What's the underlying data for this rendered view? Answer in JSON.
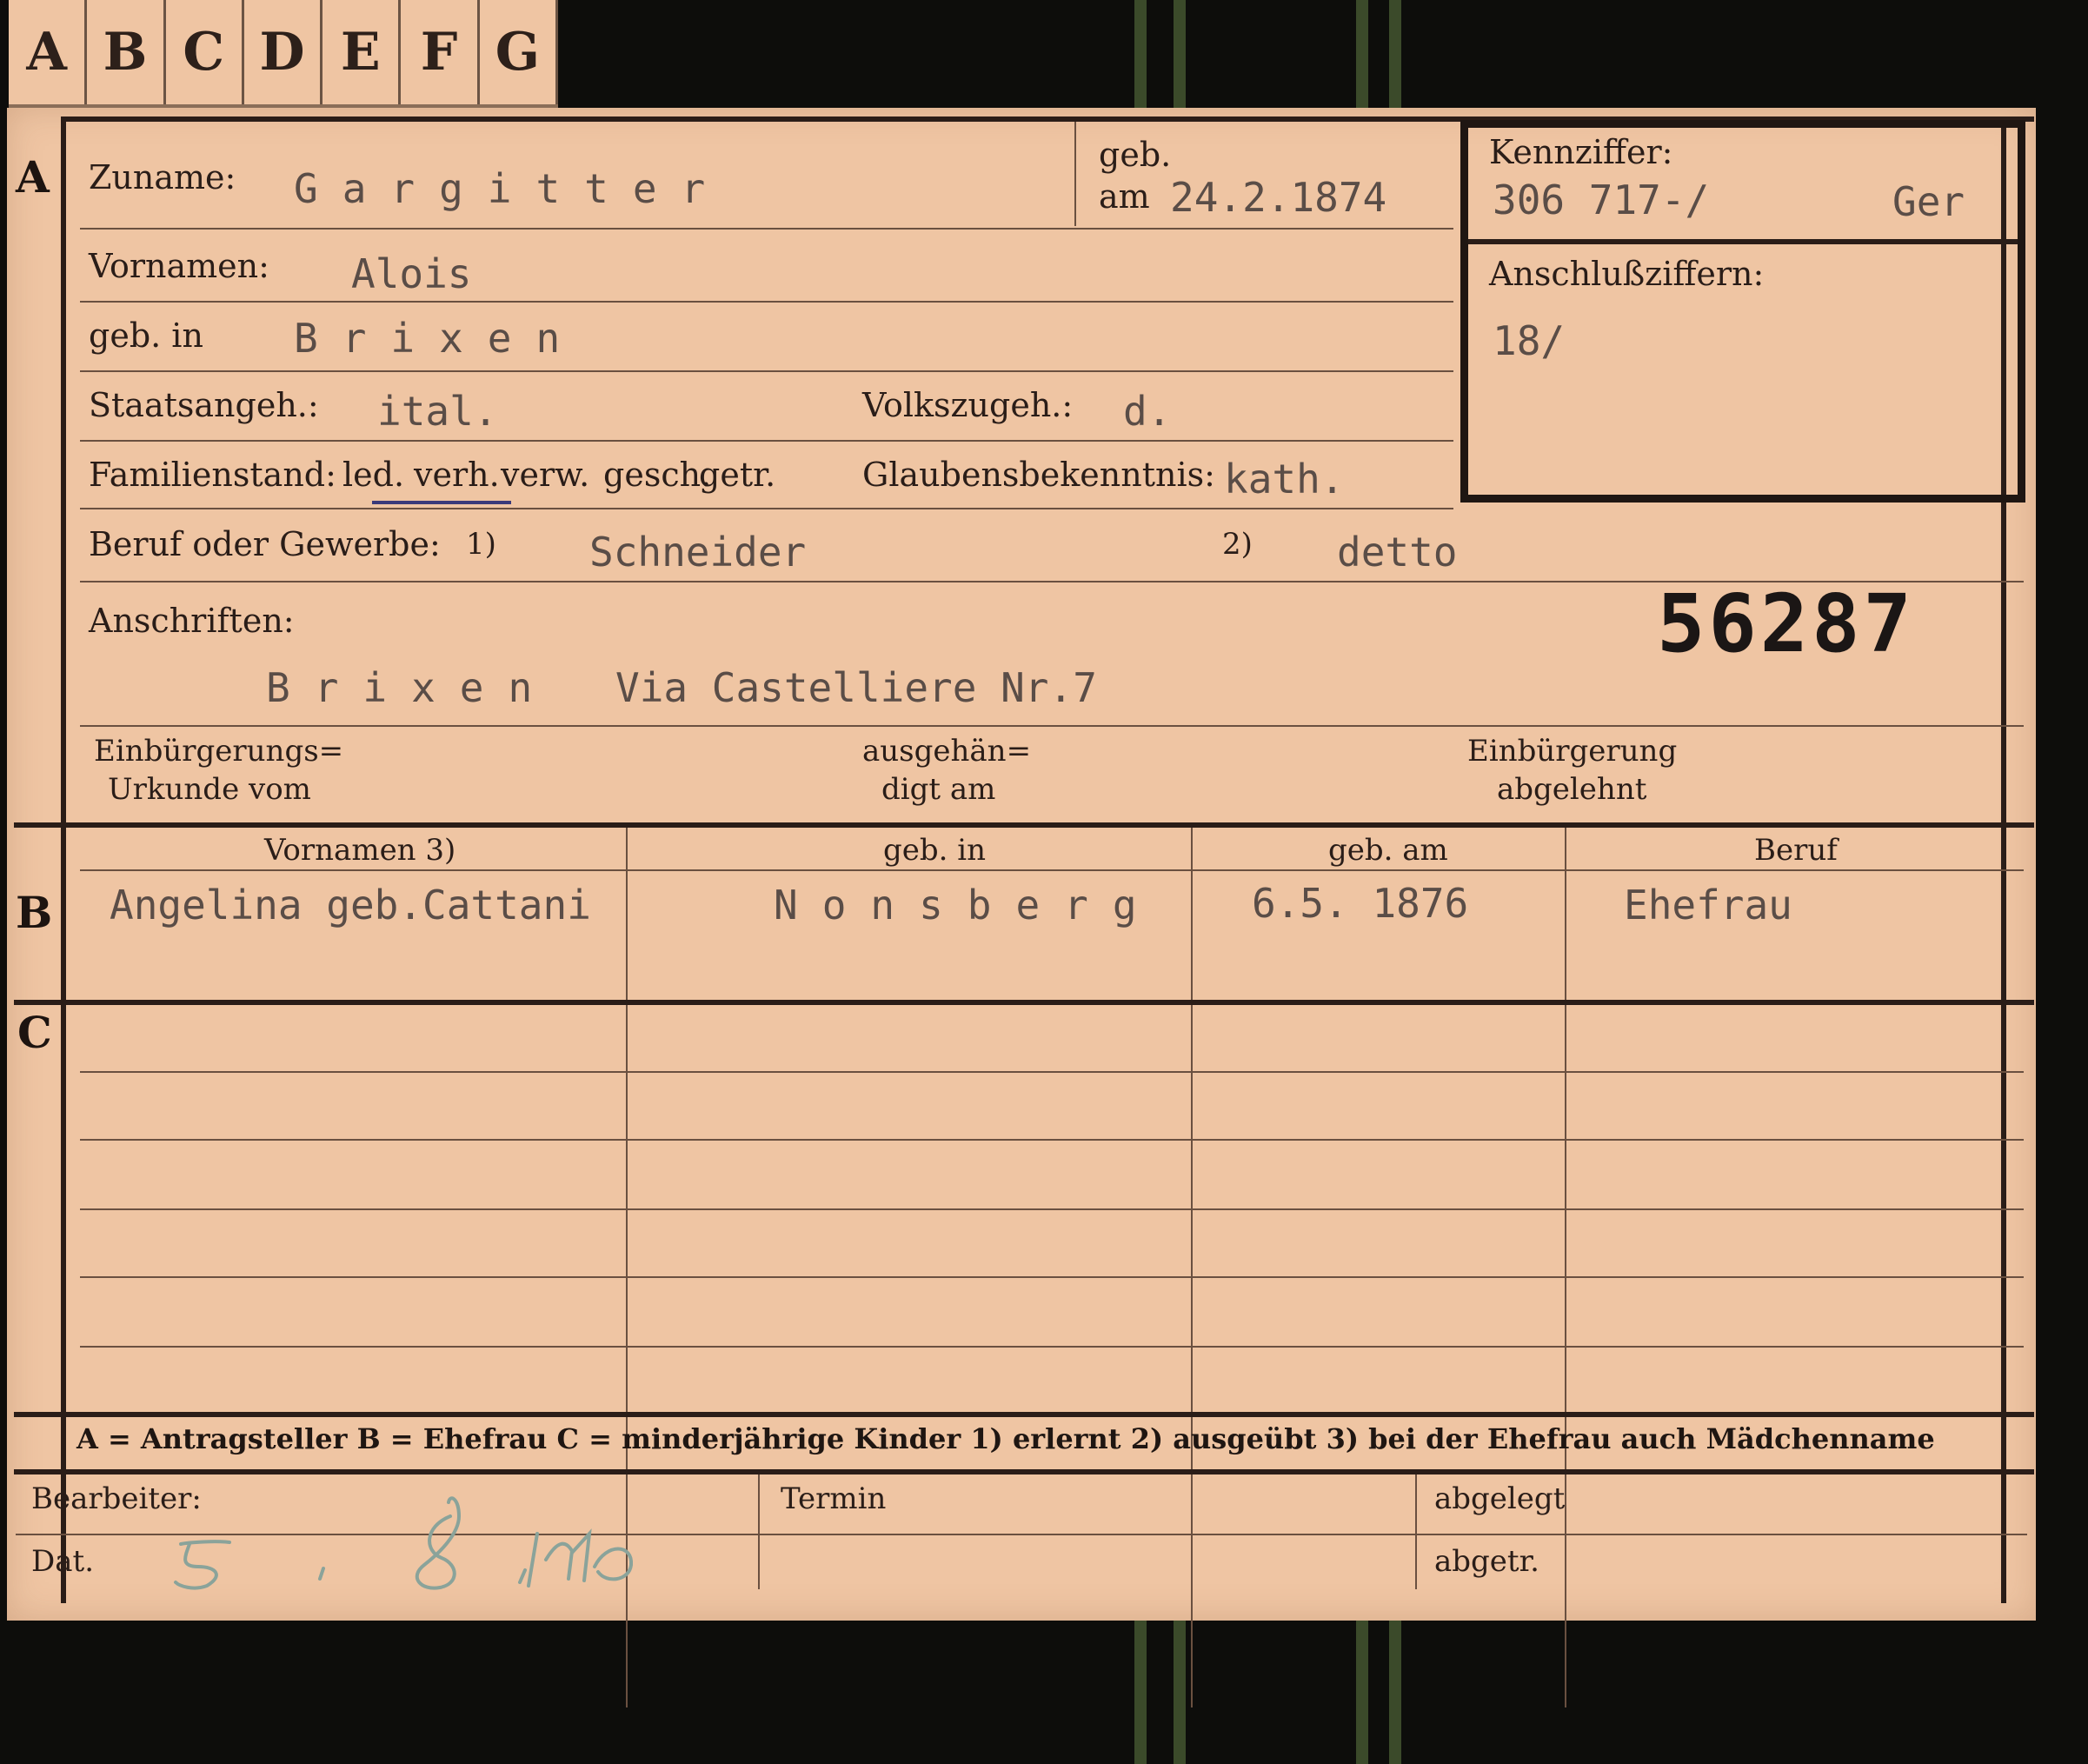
{
  "tabs": [
    "A",
    "B",
    "C",
    "D",
    "E",
    "F",
    "G"
  ],
  "sections": {
    "a": "A",
    "b": "B",
    "c": "C"
  },
  "fields": {
    "zuname_label": "Zuname:",
    "zuname_value": "Gargitter",
    "geb_label": "geb.",
    "am_label": "am",
    "geb_date": "24.2.1874",
    "kennziffer_label": "Kennziffer:",
    "kennziffer_value": "306 717-/",
    "kennziffer_suffix": "Ger",
    "anschluss_label": "Anschlußziffern:",
    "anschluss_value": "18/",
    "vornamen_label": "Vornamen:",
    "vornamen_value": "Alois",
    "gebin_label": "geb. in",
    "gebin_value": "Brixen",
    "staatsangeh_label": "Staatsangeh.:",
    "staatsangeh_value": "ital.",
    "volkszugeh_label": "Volkszugeh.:",
    "volkszugeh_value": "d.",
    "familienstand_label": "Familienstand:",
    "familienstand_options": [
      "led.",
      "verh.",
      "verw.",
      "gesch.",
      "getr."
    ],
    "glaubens_label": "Glaubensbekenntnis:",
    "glaubens_value": "kath.",
    "beruf_label": "Beruf oder Gewerbe:",
    "beruf_note1": "1)",
    "beruf_value1": "Schneider",
    "beruf_note2": "2)",
    "beruf_value2": "detto",
    "anschriften_label": "Anschriften:",
    "stamp_number": "56287",
    "address_city": "Brixen",
    "address_street": "Via Castelliere Nr.7",
    "einb_urkunde_1": "Einbürgerungs=",
    "einb_urkunde_2": "Urkunde vom",
    "ausgeh_1": "ausgehän=",
    "ausgeh_2": "digt am",
    "einb_abgel_1": "Einbürgerung",
    "einb_abgel_2": "abgelehnt"
  },
  "table": {
    "headers": [
      "Vornamen 3)",
      "geb. in",
      "geb. am",
      "Beruf"
    ],
    "row_b": [
      "Angelina geb.Cattani",
      "Nonsberg",
      "6.5. 1876",
      "Ehefrau"
    ]
  },
  "legend": "A = Antragsteller   B = Ehefrau   C = minderjährige Kinder   1) erlernt   2) ausgeübt   3) bei der Ehefrau auch Mädchenname",
  "footer": {
    "bearbeiter_label": "Bearbeiter:",
    "dat_label": "Dat.",
    "termin_label": "Termin",
    "abgelegt_label": "abgelegt",
    "abgetr_label": "abgetr.",
    "handwritten_date": "5. / 8. 1940"
  },
  "colors": {
    "paper": "#efc5a3",
    "ink": "#2a1d18",
    "typewriter": "#5a4d47",
    "handwriting": "#8aa39a"
  }
}
